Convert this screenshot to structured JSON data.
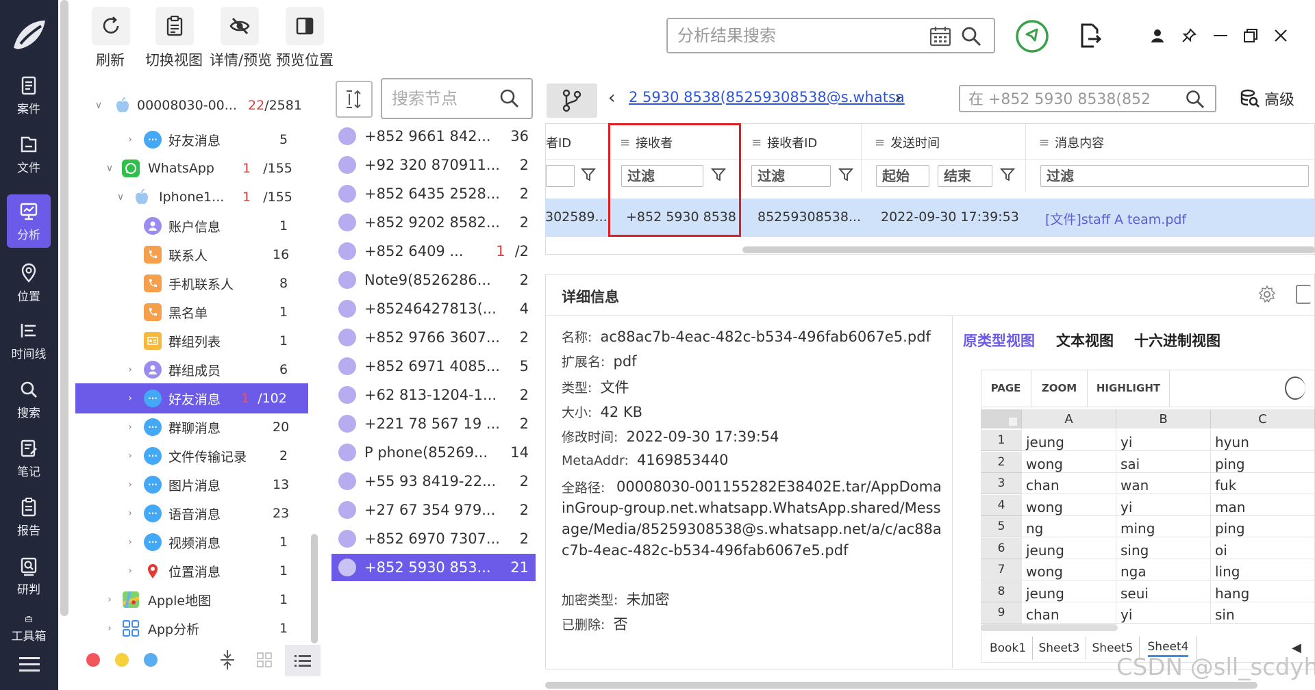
{
  "nav": {
    "items": [
      {
        "label": "案件",
        "icon": "case-icon"
      },
      {
        "label": "文件",
        "icon": "folder-icon"
      },
      {
        "label": "分析",
        "icon": "analysis-icon"
      },
      {
        "label": "位置",
        "icon": "location-icon"
      },
      {
        "label": "时间线",
        "icon": "timeline-icon"
      },
      {
        "label": "搜索",
        "icon": "search-icon"
      },
      {
        "label": "笔记",
        "icon": "note-icon"
      },
      {
        "label": "报告",
        "icon": "report-icon"
      },
      {
        "label": "研判",
        "icon": "judge-icon"
      },
      {
        "label": "工具箱",
        "icon": "toolbox-icon"
      }
    ],
    "active": "分析"
  },
  "toolbar": {
    "refresh": "刷新",
    "switch_view": "切换视图",
    "detail_preview": "详情/预览",
    "preview_position": "预览位置"
  },
  "top_search": {
    "placeholder": "分析结果搜索"
  },
  "tree": {
    "root": {
      "label": "00008030-00...",
      "count_red": "22",
      "count_total": "/2581"
    },
    "items": [
      {
        "label": "好友消息",
        "count": "5"
      },
      {
        "label": "WhatsApp",
        "count_red": "1",
        "count_total": "/155"
      },
      {
        "label": "Iphone1...",
        "count_red": "1",
        "count_total": "/155"
      },
      {
        "label": "账户信息",
        "count": "1"
      },
      {
        "label": "联系人",
        "count": "16"
      },
      {
        "label": "手机联系人",
        "count": "8"
      },
      {
        "label": "黑名单",
        "count": "1"
      },
      {
        "label": "群组列表",
        "count": "1"
      },
      {
        "label": "群组成员",
        "count": "6"
      },
      {
        "label": "好友消息",
        "count_red": "1",
        "count_total": "/102"
      },
      {
        "label": "群聊消息",
        "count": "20"
      },
      {
        "label": "文件传输记录",
        "count": "2"
      },
      {
        "label": "图片消息",
        "count": "13"
      },
      {
        "label": "语音消息",
        "count": "23"
      },
      {
        "label": "视频消息",
        "count": "1"
      },
      {
        "label": "位置消息",
        "count": "1"
      },
      {
        "label": "Apple地图",
        "count": "1"
      },
      {
        "label": "App分析",
        "count": "1"
      }
    ]
  },
  "node_search": {
    "placeholder": "搜索节点"
  },
  "nodes": [
    {
      "name": "+852 9661 842...",
      "count": "36"
    },
    {
      "name": "+92 320 870911...",
      "count": "2"
    },
    {
      "name": "+852 6435 2528...",
      "count": "2"
    },
    {
      "name": "+852 9202 8582...",
      "count": "2"
    },
    {
      "name": "+852 6409 ...",
      "count_red": "1",
      "count": "/2"
    },
    {
      "name": "Note9(8526286...",
      "count": "2"
    },
    {
      "name": "+85246427813(...",
      "count": "4"
    },
    {
      "name": "+852 9766 3607...",
      "count": "2"
    },
    {
      "name": "+852 6971 4085...",
      "count": "5"
    },
    {
      "name": "+62 813-1204-1...",
      "count": "2"
    },
    {
      "name": "+221 78 567 19 ...",
      "count": "2"
    },
    {
      "name": "P phone(85269...",
      "count": "14"
    },
    {
      "name": "+55 93 8419-22...",
      "count": "2"
    },
    {
      "name": "+27 67 354 979...",
      "count": "2"
    },
    {
      "name": "+852 6970 7307...",
      "count": "2"
    },
    {
      "name": "+852 5930 853...",
      "count": "21"
    }
  ],
  "breadcrumb": {
    "text": "2 5930 8538(85259308538@s.whatsa"
  },
  "crumb_search": {
    "placeholder": "在 +852 5930 8538(852"
  },
  "advanced": "高级",
  "grid": {
    "columns": [
      "者ID",
      "接收者",
      "接收者ID",
      "发送时间",
      "消息内容"
    ],
    "filter": "过滤",
    "start": "起始",
    "end": "结束",
    "row": [
      "302589...",
      "+852 5930 8538",
      "85259308538...",
      "2022-09-30 17:39:53",
      "[文件]staff A team.pdf"
    ]
  },
  "detail": {
    "title": "详细信息",
    "fields": [
      {
        "label": "名称:",
        "value": "ac88ac7b-4eac-482c-b534-496fab6067e5.pdf"
      },
      {
        "label": "扩展名:",
        "value": "pdf"
      },
      {
        "label": "类型:",
        "value": "文件"
      },
      {
        "label": "大小:",
        "value": "42 KB"
      },
      {
        "label": "修改时间:",
        "value": "2022-09-30 17:39:54"
      },
      {
        "label": "MetaAddr:",
        "value": "4169853440"
      }
    ],
    "fullpath_label": "全路径:",
    "fullpath_value": "00008030-001155282E38402E.tar/AppDomainGroup-group.net.whatsapp.WhatsApp.shared/Message/Media/85259308538@s.whatsapp.net/a/c/ac88ac7b-4eac-482c-b534-496fab6067e5.pdf",
    "encrypt_label": "加密类型:",
    "encrypt_value": "未加密",
    "deleted_label": "已删除:",
    "deleted_value": "否"
  },
  "view_tabs": [
    "原类型视图",
    "文本视图",
    "十六进制视图"
  ],
  "sheet": {
    "toolbar": [
      "PAGE",
      "ZOOM",
      "HIGHLIGHT"
    ],
    "columns": [
      "A",
      "B",
      "C"
    ],
    "rows": [
      [
        "1",
        "jeung",
        "yi",
        "hyun"
      ],
      [
        "2",
        "wong",
        "sai",
        "ping"
      ],
      [
        "3",
        "chan",
        "wan",
        "fuk"
      ],
      [
        "4",
        "wong",
        "yi",
        "man"
      ],
      [
        "5",
        "ng",
        "ming",
        "ping"
      ],
      [
        "6",
        "jeung",
        "sing",
        "oi"
      ],
      [
        "7",
        "wong",
        "nga",
        "ling"
      ],
      [
        "8",
        "jeung",
        "seui",
        "hang"
      ],
      [
        "9",
        "chan",
        "yi",
        "sin"
      ]
    ],
    "tabs": [
      "Book1",
      "Sheet3",
      "Sheet5",
      "Sheet4"
    ],
    "active_tab": "Sheet4"
  },
  "watermark": "CSDN @sll_scdyh",
  "colors": {
    "accent": "#6b5be8",
    "nav_bg": "#22283a",
    "red": "#e02020",
    "link": "#2f56d8"
  }
}
